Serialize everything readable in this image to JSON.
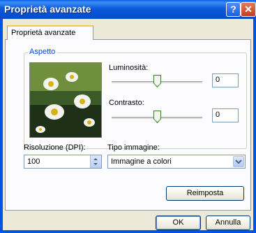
{
  "window": {
    "title": "Proprietà avanzate"
  },
  "tabs": [
    {
      "label": "Proprietà avanzate",
      "active": true
    }
  ],
  "aspetto": {
    "group_label": "Aspetto",
    "brightness": {
      "label": "Luminosità:",
      "value": "0"
    },
    "contrast": {
      "label": "Contrasto:",
      "value": "0"
    }
  },
  "resolution": {
    "label": "Risoluzione (DPI):",
    "value": "100"
  },
  "image_type": {
    "label": "Tipo immagine:",
    "selected": "Immagine a colori"
  },
  "buttons": {
    "reset": "Reimposta",
    "ok": "OK",
    "cancel": "Annulla"
  },
  "colors": {
    "titlebar": "#0054e3",
    "dialog_bg": "#ece9d8",
    "group_label": "#0046d5"
  },
  "icons": [
    "help-icon",
    "close-icon",
    "spin-up-icon",
    "spin-down-icon",
    "chevron-down-icon",
    "slider-thumb-icon"
  ]
}
